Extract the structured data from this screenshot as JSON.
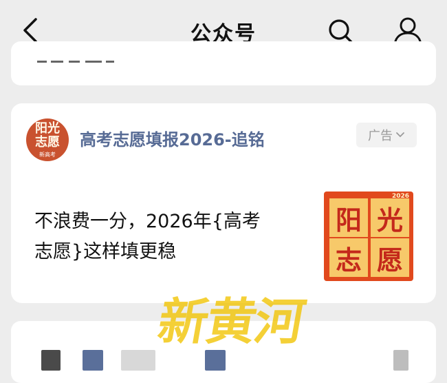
{
  "header": {
    "title": "公众号",
    "back_icon": "chevron-left-icon",
    "search_icon": "search-icon",
    "profile_icon": "person-icon"
  },
  "ad": {
    "account_name": "高考志愿填报2026-追铭",
    "badge_label": "广告",
    "text_line1": "不浪费一分，2026年{高考",
    "text_line2": "志愿}这样填更稳",
    "avatar": {
      "line1": "阳光",
      "line2": "志愿",
      "sub": "新高考"
    },
    "thumbnail": {
      "year": "2026",
      "chars": [
        "阳",
        "光",
        "志",
        "愿"
      ],
      "colors": {
        "background": "#e1491d",
        "tile": "#f7c96a",
        "text": "#c4291b"
      }
    }
  },
  "watermark": "新黄河",
  "colors": {
    "link_blue": "#576b95",
    "page_bg": "#ededed",
    "watermark": "#f2c400"
  }
}
